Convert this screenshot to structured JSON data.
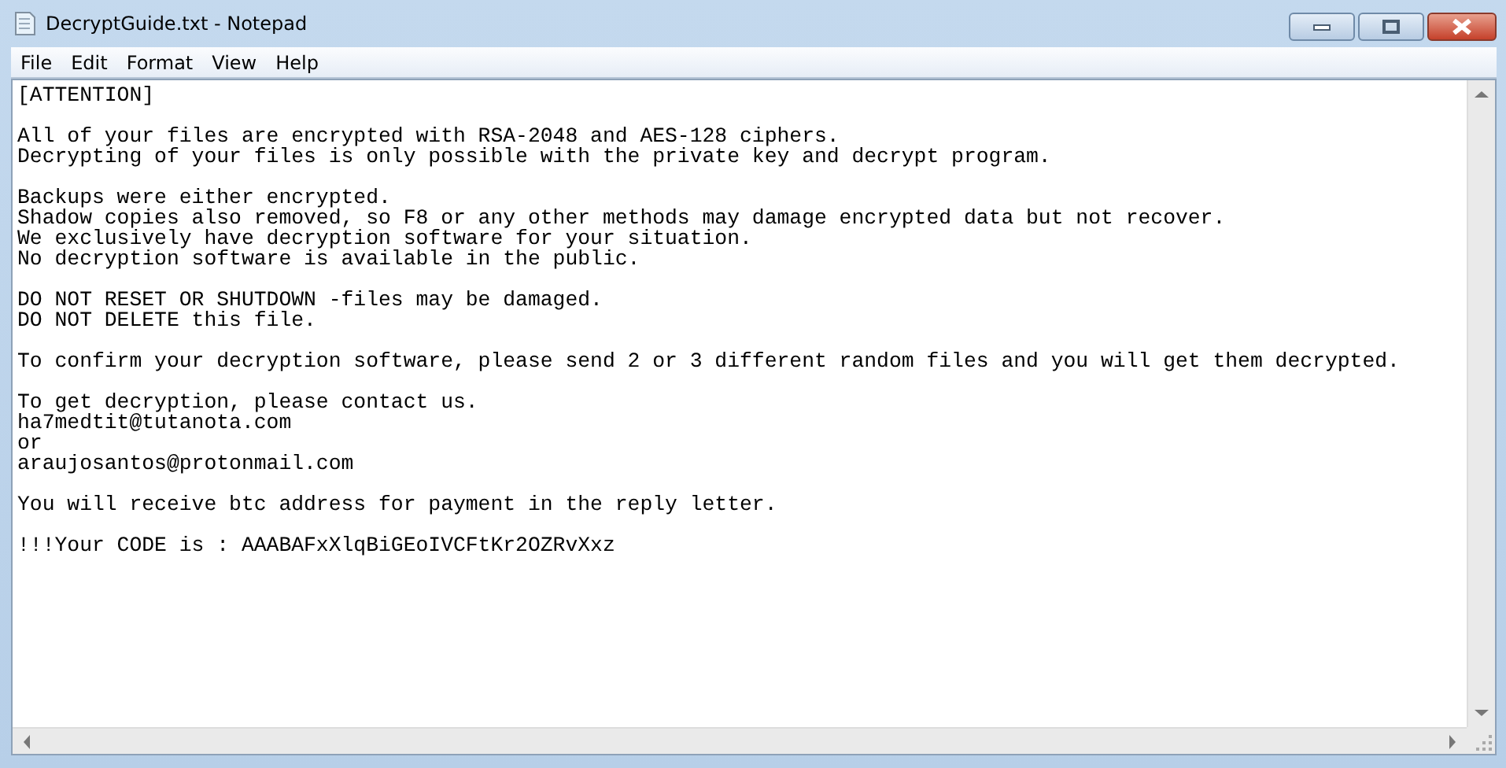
{
  "window": {
    "title": "DecryptGuide.txt - Notepad"
  },
  "menu": [
    "File",
    "Edit",
    "Format",
    "View",
    "Help"
  ],
  "document": {
    "paragraphs": [
      [
        "[ATTENTION]"
      ],
      [
        "All of your files are encrypted with RSA-2048 and AES-128 ciphers.",
        "Decrypting of your files is only possible with the private key and decrypt program."
      ],
      [
        "Backups were either encrypted.",
        "Shadow copies also removed, so F8 or any other methods may damage encrypted data but not recover.",
        "We exclusively have decryption software for your situation.",
        "No decryption software is available in the public."
      ],
      [
        "DO NOT RESET OR SHUTDOWN -files may be damaged.",
        "DO NOT DELETE this file."
      ],
      [
        "To confirm your decryption software, please send 2 or 3 different random files and you will get them decrypted."
      ],
      [
        "To get decryption, please contact us.",
        "ha7medtit@tutanota.com",
        "or",
        "araujosantos@protonmail.com"
      ],
      [
        "You will receive btc address for payment in the reply letter."
      ],
      [
        "!!!Your CODE is : AAABAFxXlqBiGEoIVCFtKr2OZRvXxz"
      ]
    ]
  }
}
